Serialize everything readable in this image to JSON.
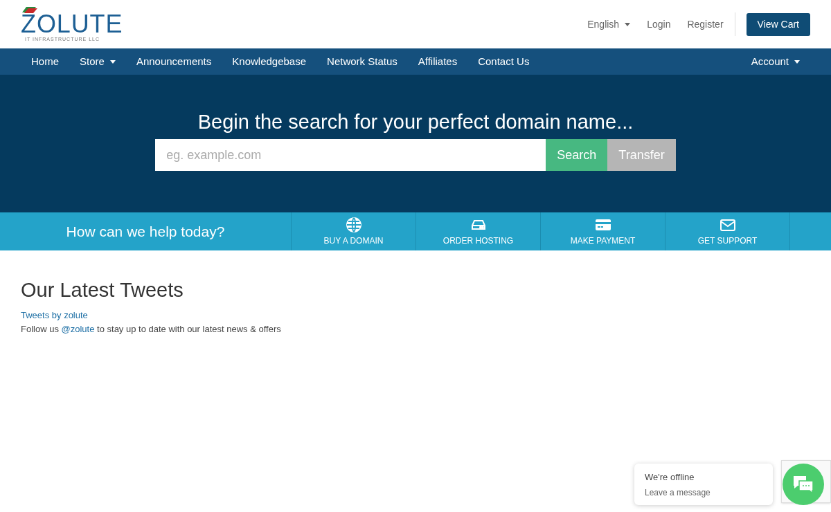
{
  "logo": {
    "name": "ZOLUTE",
    "tagline": "IT INFRASTRUCTURE LLC"
  },
  "top_links": [
    {
      "label": "English",
      "dropdown": true
    },
    {
      "label": "Login",
      "dropdown": false
    },
    {
      "label": "Register",
      "dropdown": false
    }
  ],
  "cart_button": "View Cart",
  "nav": {
    "items": [
      {
        "label": "Home",
        "dropdown": false
      },
      {
        "label": "Store",
        "dropdown": true
      },
      {
        "label": "Announcements",
        "dropdown": false
      },
      {
        "label": "Knowledgebase",
        "dropdown": false
      },
      {
        "label": "Network Status",
        "dropdown": false
      },
      {
        "label": "Affiliates",
        "dropdown": false
      },
      {
        "label": "Contact Us",
        "dropdown": false
      }
    ],
    "account": {
      "label": "Account",
      "dropdown": true
    }
  },
  "hero": {
    "title": "Begin the search for your perfect domain name...",
    "placeholder": "eg. example.com",
    "buttons": [
      {
        "label": "Search",
        "kind": "primary"
      },
      {
        "label": "Transfer",
        "kind": "secondary"
      }
    ]
  },
  "help": {
    "title": "How can we help today?",
    "actions": [
      {
        "label": "BUY A DOMAIN",
        "kind": "globe"
      },
      {
        "label": "ORDER HOSTING",
        "kind": "server"
      },
      {
        "label": "MAKE PAYMENT",
        "kind": "card"
      },
      {
        "label": "GET SUPPORT",
        "kind": "mail"
      }
    ]
  },
  "tweets": {
    "title": "Our Latest Tweets",
    "link": "Tweets by zolute",
    "follow_prefix": "Follow us",
    "follow_link": "@zolute",
    "follow_suffix": "to stay up to date with our latest news & offers"
  },
  "chat": {
    "status": "We're offline",
    "action": "Leave a message"
  }
}
